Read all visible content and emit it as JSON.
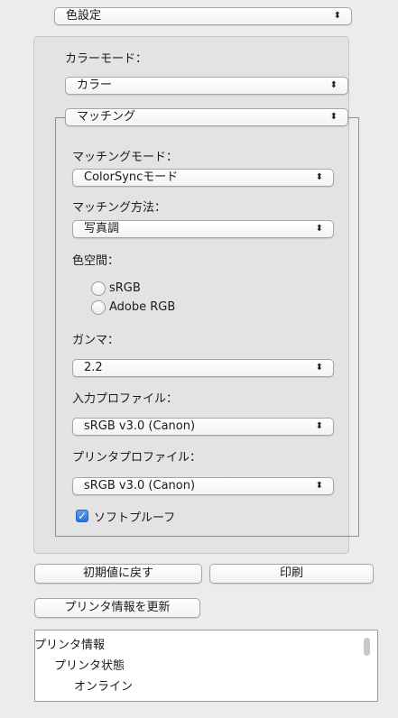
{
  "color_settings_popup": {
    "value": "色設定"
  },
  "color_mode": {
    "label": "カラーモード：",
    "value": "カラー"
  },
  "matching_popup": {
    "value": "マッチング"
  },
  "matching_mode": {
    "label": "マッチングモード：",
    "value": "ColorSyncモード"
  },
  "matching_method": {
    "label": "マッチング方法：",
    "value": "写真調"
  },
  "color_space": {
    "label": "色空間：",
    "options": [
      "sRGB",
      "Adobe RGB"
    ]
  },
  "gamma": {
    "label": "ガンマ：",
    "value": "2.2"
  },
  "input_profile": {
    "label": "入力プロファイル：",
    "value": "sRGB v3.0 (Canon)"
  },
  "printer_profile": {
    "label": "プリンタプロファイル：",
    "value": "sRGB v3.0 (Canon)"
  },
  "soft_proof": {
    "label": "ソフトプルーフ",
    "checked": true
  },
  "buttons": {
    "reset": "初期値に戻す",
    "print": "印刷",
    "update_printer_info": "プリンタ情報を更新"
  },
  "printer_info": {
    "items": [
      "プリンタ情報",
      "プリンタ状態",
      "オンライン"
    ]
  },
  "icons": {
    "popup_arrows": "updown-arrows-icon",
    "check": "checkmark-icon"
  }
}
